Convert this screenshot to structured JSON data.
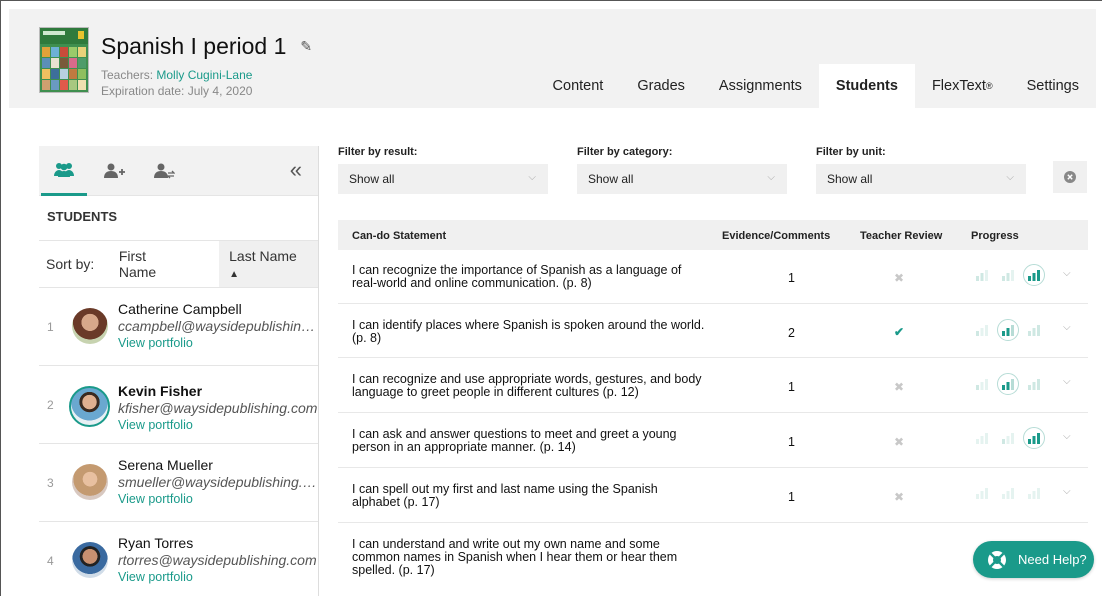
{
  "header": {
    "course_title": "Spanish I period 1",
    "teachers_label": "Teachers:",
    "teacher_name": "Molly Cugini-Lane",
    "expiration": "Expiration date: July 4, 2020",
    "edit_icon": "pencil-icon"
  },
  "tabs": [
    {
      "label": "Content",
      "active": false
    },
    {
      "label": "Grades",
      "active": false
    },
    {
      "label": "Assignments",
      "active": false
    },
    {
      "label": "Students",
      "active": true
    },
    {
      "label": "FlexText",
      "sup": "®",
      "active": false
    },
    {
      "label": "Settings",
      "active": false
    }
  ],
  "sidebar": {
    "heading": "STUDENTS",
    "sort_label": "Sort by:",
    "sort_first": "First Name",
    "sort_last": "Last Name",
    "sort_arrow": "^",
    "collapse_glyph": "«",
    "students": [
      {
        "num": "1",
        "name": "Catherine Campbell",
        "email": "ccampbell@waysidepublishing.com",
        "link": "View portfolio"
      },
      {
        "num": "2",
        "name": "Kevin Fisher",
        "email": "kfisher@waysidepublishing.com",
        "link": "View portfolio"
      },
      {
        "num": "3",
        "name": "Serena Mueller",
        "email": "smueller@waysidepublishing.com",
        "link": "View portfolio"
      },
      {
        "num": "4",
        "name": "Ryan Torres",
        "email": "rtorres@waysidepublishing.com",
        "link": "View portfolio"
      }
    ]
  },
  "filters": {
    "result_label": "Filter by result:",
    "result_value": "Show all",
    "category_label": "Filter by category:",
    "category_value": "Show all",
    "unit_label": "Filter by unit:",
    "unit_value": "Show all"
  },
  "table": {
    "headers": [
      "Can-do Statement",
      "Evidence/Comments",
      "Teacher Review",
      "Progress"
    ],
    "rows": [
      {
        "line1": "I can recognize the importance of Spanish as a language of",
        "line2": "real-world and online communication. (p. 8)",
        "line3": "",
        "evidence": "1",
        "review": "✖"
      },
      {
        "line1": "I can identify places where Spanish is spoken around the world.",
        "line2": "(p. 8)",
        "line3": "",
        "evidence": "2",
        "review": "✔"
      },
      {
        "line1": "I can recognize and use appropriate words, gestures, and body",
        "line2": "language to greet people in different cultures (p. 12)",
        "line3": "",
        "evidence": "1",
        "review": "✖"
      },
      {
        "line1": "I can ask and answer questions to meet and greet a young",
        "line2": "person in an appropriate manner. (p. 14)",
        "line3": "",
        "evidence": "1",
        "review": "✖"
      },
      {
        "line1": "I can spell out my first and last name using the Spanish",
        "line2": "alphabet (p. 17)",
        "line3": "",
        "evidence": "1",
        "review": "✖"
      },
      {
        "line1": "I can understand and write out my own name and some",
        "line2": "common names in Spanish when I hear them or hear them",
        "line3": "spelled. (p. 17)",
        "evidence": "",
        "review": ""
      }
    ]
  },
  "help": {
    "label": "Need Help?"
  },
  "colors": {
    "accent": "#1a9a8a",
    "header_bg": "#f2f2f2"
  }
}
